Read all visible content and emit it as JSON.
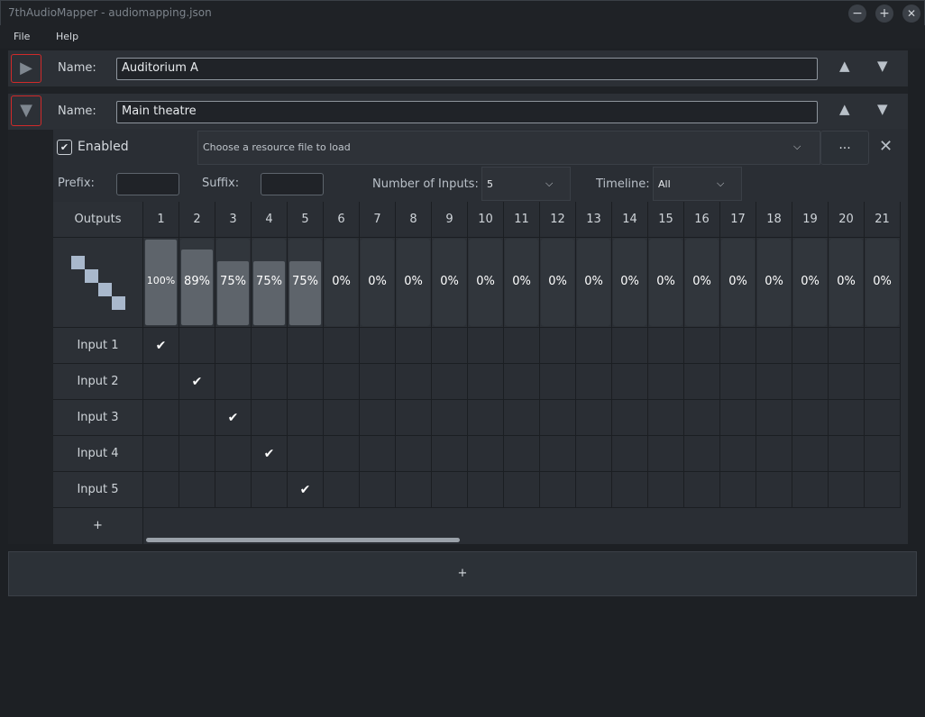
{
  "window": {
    "title": "7thAudioMapper - audiomapping.json",
    "minimize": "−",
    "maximize": "+",
    "close": "✕"
  },
  "menu": {
    "file": "File",
    "help": "Help"
  },
  "groups": [
    {
      "name_label": "Name:",
      "name": "Auditorium A",
      "expand_icon": "▶"
    },
    {
      "name_label": "Name:",
      "name": "Main theatre",
      "expand_icon": "▼"
    }
  ],
  "move_up": "▲",
  "move_down": "▼",
  "settings": {
    "enabled_label": "Enabled",
    "enabled_check": "✔",
    "resource_placeholder": "Choose a resource file to load",
    "browse_label": "...",
    "close_label": "✕",
    "prefix_label": "Prefix:",
    "suffix_label": "Suffix:",
    "num_inputs_label": "Number of Inputs:",
    "num_inputs_value": "5",
    "timeline_label": "Timeline:",
    "timeline_value": "All",
    "chevron": "⌵"
  },
  "matrix": {
    "outputs_label": "Outputs",
    "columns": [
      "1",
      "2",
      "3",
      "4",
      "5",
      "6",
      "7",
      "8",
      "9",
      "10",
      "11",
      "12",
      "13",
      "14",
      "15",
      "16",
      "17",
      "18",
      "19",
      "20",
      "21"
    ],
    "volumes": [
      "100%",
      "89%",
      "75%",
      "75%",
      "75%",
      "0%",
      "0%",
      "0%",
      "0%",
      "0%",
      "0%",
      "0%",
      "0%",
      "0%",
      "0%",
      "0%",
      "0%",
      "0%",
      "0%",
      "0%",
      "0%"
    ],
    "volume_levels": [
      100,
      89,
      75,
      75,
      75,
      0,
      0,
      0,
      0,
      0,
      0,
      0,
      0,
      0,
      0,
      0,
      0,
      0,
      0,
      0,
      0
    ],
    "inputs": [
      "Input 1",
      "Input 2",
      "Input 3",
      "Input 4",
      "Input 5"
    ],
    "checked_output_index_per_input": [
      0,
      1,
      2,
      3,
      4
    ],
    "check_mark": "✔",
    "add_input_label": "+"
  },
  "add_group_label": "+"
}
